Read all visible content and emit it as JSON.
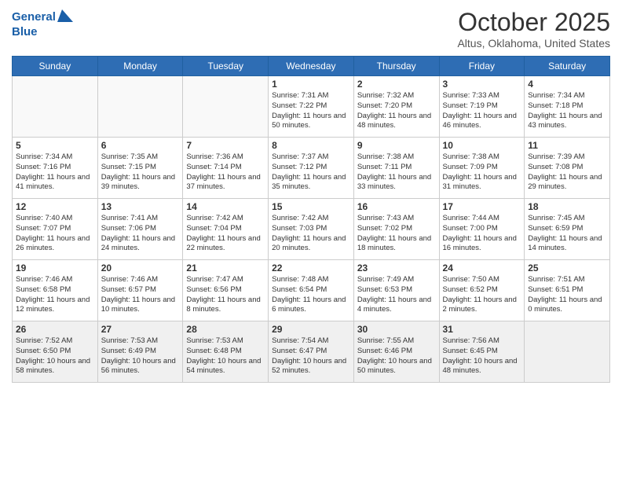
{
  "header": {
    "logo_line1": "General",
    "logo_line2": "Blue",
    "month": "October 2025",
    "location": "Altus, Oklahoma, United States"
  },
  "weekdays": [
    "Sunday",
    "Monday",
    "Tuesday",
    "Wednesday",
    "Thursday",
    "Friday",
    "Saturday"
  ],
  "weeks": [
    [
      {
        "day": "",
        "info": ""
      },
      {
        "day": "",
        "info": ""
      },
      {
        "day": "",
        "info": ""
      },
      {
        "day": "1",
        "info": "Sunrise: 7:31 AM\nSunset: 7:22 PM\nDaylight: 11 hours\nand 50 minutes."
      },
      {
        "day": "2",
        "info": "Sunrise: 7:32 AM\nSunset: 7:20 PM\nDaylight: 11 hours\nand 48 minutes."
      },
      {
        "day": "3",
        "info": "Sunrise: 7:33 AM\nSunset: 7:19 PM\nDaylight: 11 hours\nand 46 minutes."
      },
      {
        "day": "4",
        "info": "Sunrise: 7:34 AM\nSunset: 7:18 PM\nDaylight: 11 hours\nand 43 minutes."
      }
    ],
    [
      {
        "day": "5",
        "info": "Sunrise: 7:34 AM\nSunset: 7:16 PM\nDaylight: 11 hours\nand 41 minutes."
      },
      {
        "day": "6",
        "info": "Sunrise: 7:35 AM\nSunset: 7:15 PM\nDaylight: 11 hours\nand 39 minutes."
      },
      {
        "day": "7",
        "info": "Sunrise: 7:36 AM\nSunset: 7:14 PM\nDaylight: 11 hours\nand 37 minutes."
      },
      {
        "day": "8",
        "info": "Sunrise: 7:37 AM\nSunset: 7:12 PM\nDaylight: 11 hours\nand 35 minutes."
      },
      {
        "day": "9",
        "info": "Sunrise: 7:38 AM\nSunset: 7:11 PM\nDaylight: 11 hours\nand 33 minutes."
      },
      {
        "day": "10",
        "info": "Sunrise: 7:38 AM\nSunset: 7:09 PM\nDaylight: 11 hours\nand 31 minutes."
      },
      {
        "day": "11",
        "info": "Sunrise: 7:39 AM\nSunset: 7:08 PM\nDaylight: 11 hours\nand 29 minutes."
      }
    ],
    [
      {
        "day": "12",
        "info": "Sunrise: 7:40 AM\nSunset: 7:07 PM\nDaylight: 11 hours\nand 26 minutes."
      },
      {
        "day": "13",
        "info": "Sunrise: 7:41 AM\nSunset: 7:06 PM\nDaylight: 11 hours\nand 24 minutes."
      },
      {
        "day": "14",
        "info": "Sunrise: 7:42 AM\nSunset: 7:04 PM\nDaylight: 11 hours\nand 22 minutes."
      },
      {
        "day": "15",
        "info": "Sunrise: 7:42 AM\nSunset: 7:03 PM\nDaylight: 11 hours\nand 20 minutes."
      },
      {
        "day": "16",
        "info": "Sunrise: 7:43 AM\nSunset: 7:02 PM\nDaylight: 11 hours\nand 18 minutes."
      },
      {
        "day": "17",
        "info": "Sunrise: 7:44 AM\nSunset: 7:00 PM\nDaylight: 11 hours\nand 16 minutes."
      },
      {
        "day": "18",
        "info": "Sunrise: 7:45 AM\nSunset: 6:59 PM\nDaylight: 11 hours\nand 14 minutes."
      }
    ],
    [
      {
        "day": "19",
        "info": "Sunrise: 7:46 AM\nSunset: 6:58 PM\nDaylight: 11 hours\nand 12 minutes."
      },
      {
        "day": "20",
        "info": "Sunrise: 7:46 AM\nSunset: 6:57 PM\nDaylight: 11 hours\nand 10 minutes."
      },
      {
        "day": "21",
        "info": "Sunrise: 7:47 AM\nSunset: 6:56 PM\nDaylight: 11 hours\nand 8 minutes."
      },
      {
        "day": "22",
        "info": "Sunrise: 7:48 AM\nSunset: 6:54 PM\nDaylight: 11 hours\nand 6 minutes."
      },
      {
        "day": "23",
        "info": "Sunrise: 7:49 AM\nSunset: 6:53 PM\nDaylight: 11 hours\nand 4 minutes."
      },
      {
        "day": "24",
        "info": "Sunrise: 7:50 AM\nSunset: 6:52 PM\nDaylight: 11 hours\nand 2 minutes."
      },
      {
        "day": "25",
        "info": "Sunrise: 7:51 AM\nSunset: 6:51 PM\nDaylight: 11 hours\nand 0 minutes."
      }
    ],
    [
      {
        "day": "26",
        "info": "Sunrise: 7:52 AM\nSunset: 6:50 PM\nDaylight: 10 hours\nand 58 minutes."
      },
      {
        "day": "27",
        "info": "Sunrise: 7:53 AM\nSunset: 6:49 PM\nDaylight: 10 hours\nand 56 minutes."
      },
      {
        "day": "28",
        "info": "Sunrise: 7:53 AM\nSunset: 6:48 PM\nDaylight: 10 hours\nand 54 minutes."
      },
      {
        "day": "29",
        "info": "Sunrise: 7:54 AM\nSunset: 6:47 PM\nDaylight: 10 hours\nand 52 minutes."
      },
      {
        "day": "30",
        "info": "Sunrise: 7:55 AM\nSunset: 6:46 PM\nDaylight: 10 hours\nand 50 minutes."
      },
      {
        "day": "31",
        "info": "Sunrise: 7:56 AM\nSunset: 6:45 PM\nDaylight: 10 hours\nand 48 minutes."
      },
      {
        "day": "",
        "info": ""
      }
    ]
  ]
}
